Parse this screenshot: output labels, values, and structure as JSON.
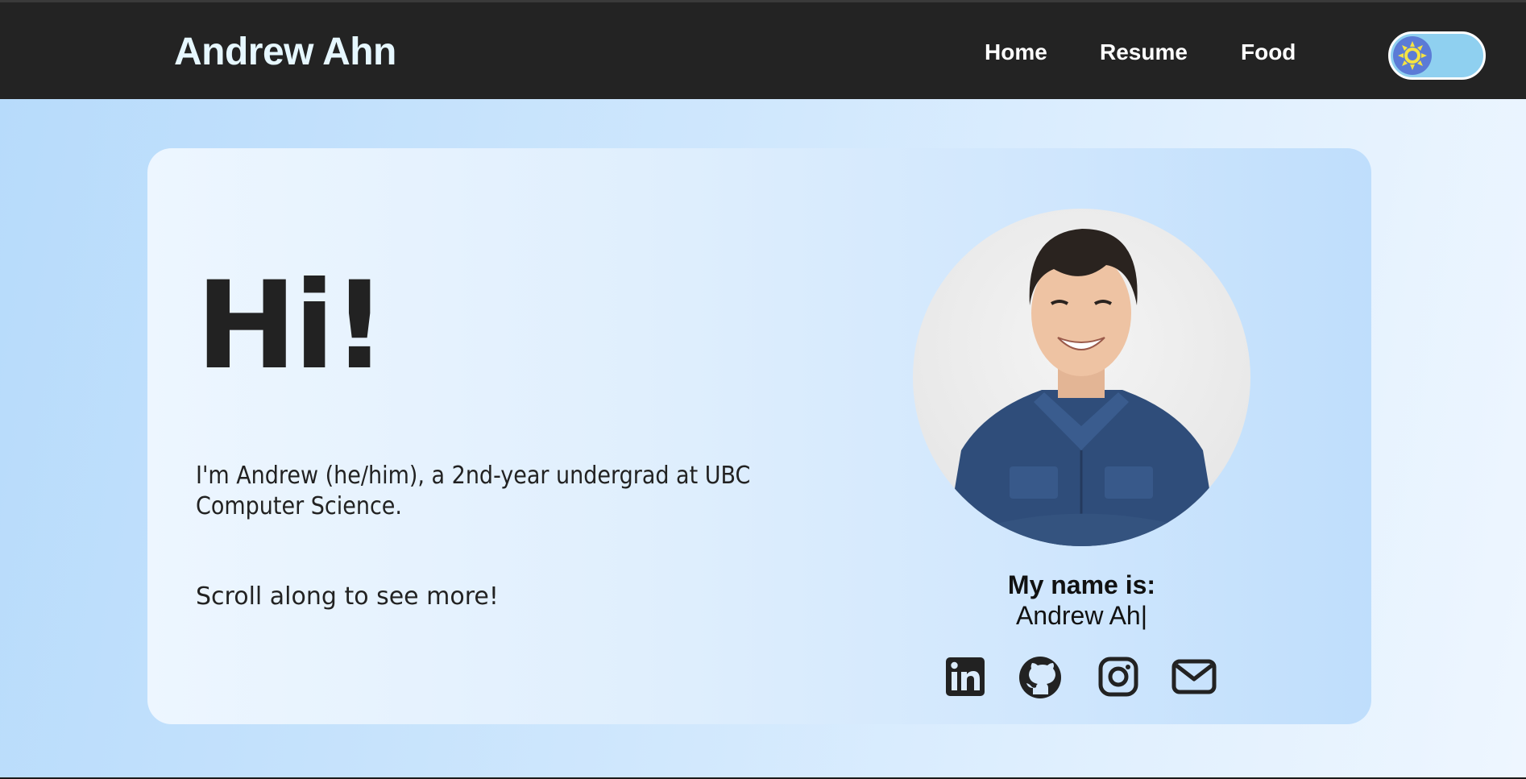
{
  "header": {
    "brand": "Andrew Ahn",
    "nav": [
      {
        "label": "Home"
      },
      {
        "label": "Resume"
      },
      {
        "label": "Food"
      }
    ],
    "theme_toggle": {
      "icon": "sun-icon",
      "state": "light"
    }
  },
  "hero": {
    "greeting": "Hi!",
    "intro": "I'm Andrew (he/him), a 2nd-year undergrad at UBC Computer Science.",
    "scroll_prompt": "Scroll along to see more!",
    "name_label": "My name is:",
    "name_typed": "Andrew Ah|",
    "socials": [
      {
        "icon": "linkedin-icon"
      },
      {
        "icon": "github-icon"
      },
      {
        "icon": "instagram-icon"
      },
      {
        "icon": "email-icon"
      }
    ]
  },
  "colors": {
    "navbar": "#232323",
    "brand_text": "#e6f7ff",
    "toggle_track": "#8fd0f0",
    "toggle_knob": "#5b7bd6",
    "sun": "#f5e342",
    "text_dark": "#222222"
  }
}
